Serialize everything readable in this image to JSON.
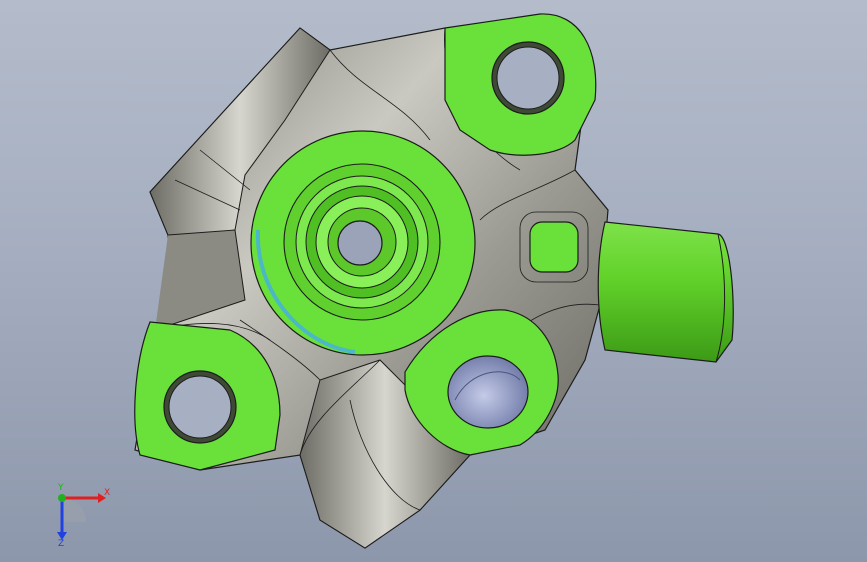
{
  "viewport": {
    "background_top": "#b4bccb",
    "background_bottom": "#8d97ab"
  },
  "model": {
    "face_color": "#6ae03a",
    "face_shade": "#4fbf23",
    "body_color": "#a5a59c",
    "bore_color": "#8e99c7",
    "edge_color": "#1c1c1c"
  },
  "triad": {
    "x_label": "X",
    "y_label": "Y",
    "z_label": "Z",
    "x_color": "#e02020",
    "y_color": "#20b020",
    "z_color": "#2040e0"
  }
}
